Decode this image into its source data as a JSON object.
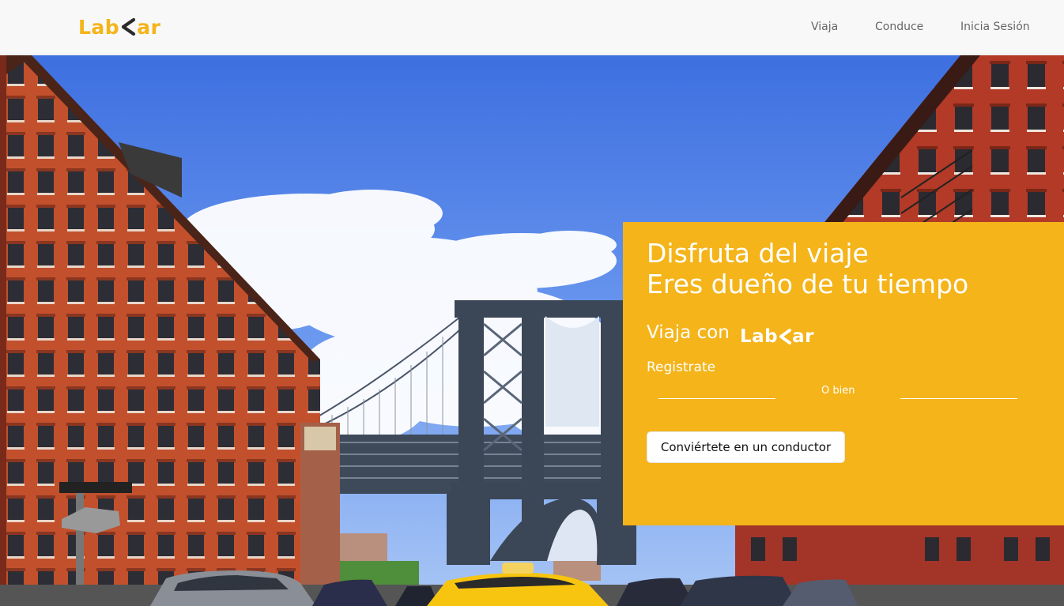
{
  "brand": {
    "logo_left": "Lab",
    "logo_right": "ar",
    "accent_color": "#f4b41a",
    "logo_icon": "chevron-left-icon"
  },
  "nav": {
    "items": [
      {
        "label": "Viaja"
      },
      {
        "label": "Conduce"
      },
      {
        "label": "Inicia Sesión"
      }
    ]
  },
  "hero": {
    "background_image": "photo of the Manhattan Bridge between brick buildings with a yellow taxi",
    "panel_color": "#f4b41a",
    "headline_line1": "Disfruta del viaje",
    "headline_line2": "Eres dueño de tu tiempo",
    "viaja_con": "Viaja con",
    "registrate": "Registrate",
    "divider_text": "O bien",
    "driver_button": "Conviértete en un conductor"
  }
}
